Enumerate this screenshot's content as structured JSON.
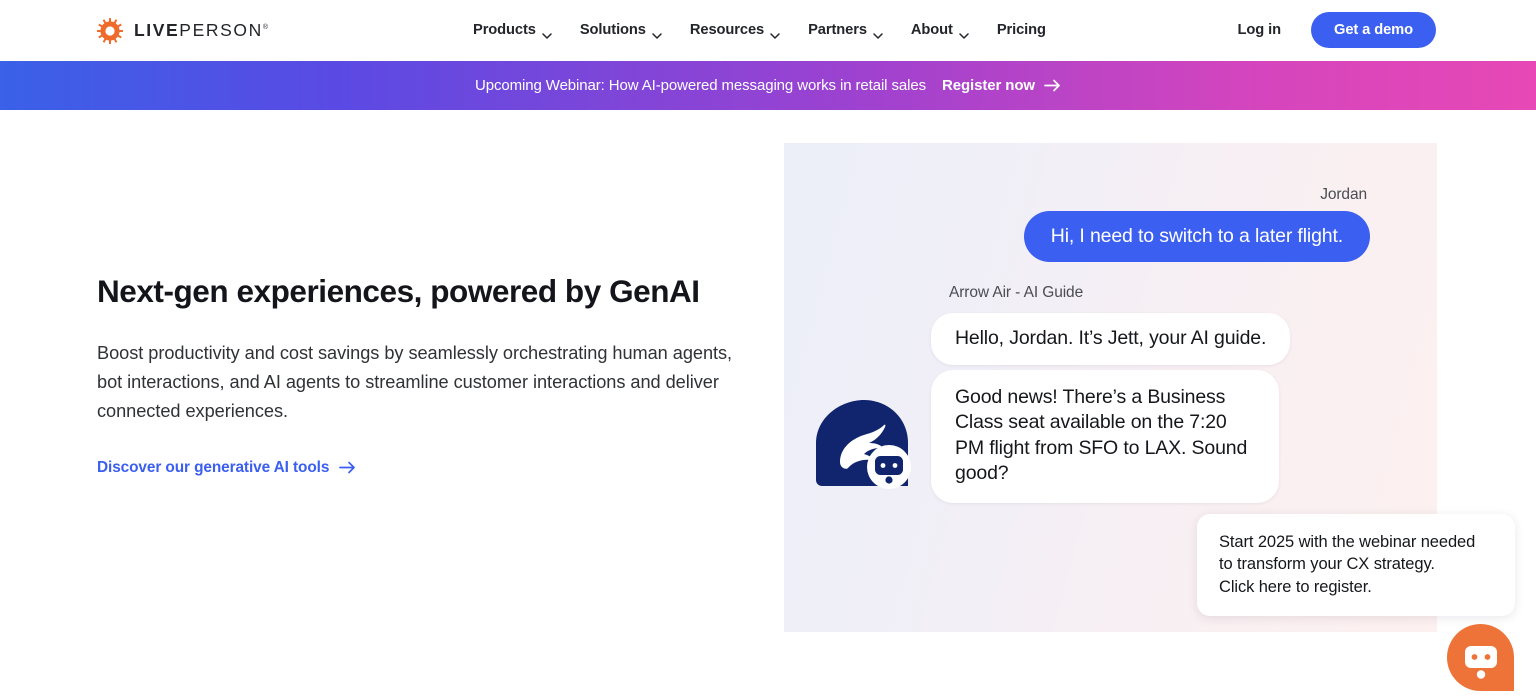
{
  "header": {
    "logo": {
      "icon": "liveperson-sun-icon",
      "text_bold": "LIVE",
      "text_regular": "PERSON",
      "trademark": "®"
    },
    "nav_items": [
      {
        "label": "Products",
        "has_dropdown": true
      },
      {
        "label": "Solutions",
        "has_dropdown": true
      },
      {
        "label": "Resources",
        "has_dropdown": true
      },
      {
        "label": "Partners",
        "has_dropdown": true
      },
      {
        "label": "About",
        "has_dropdown": true
      },
      {
        "label": "Pricing",
        "has_dropdown": false
      }
    ],
    "login_label": "Log in",
    "demo_label": "Get a demo",
    "accent_color": "#3b5ff0"
  },
  "banner": {
    "text": "Upcoming Webinar: How AI-powered messaging works in retail sales",
    "cta_label": "Register now",
    "cta_icon": "arrow-right-icon",
    "gradient_from": "#3a61e8",
    "gradient_to": "#e748b5"
  },
  "hero": {
    "title": "Next-gen experiences, powered by GenAI",
    "body": "Boost productivity and cost savings by seamlessly orchestrating human agents, bot interactions, and AI agents to streamline customer interactions and deliver connected experiences.",
    "link_label": "Discover our generative AI tools",
    "link_icon": "arrow-right-icon",
    "link_color": "#3b5ff0"
  },
  "chat": {
    "user_name": "Jordan",
    "agent_name": "Arrow Air - AI Guide",
    "user_message": "Hi, I need to switch to a later flight.",
    "agent_message_1": "Hello, Jordan. It’s Jett, your AI guide.",
    "agent_message_2": "Good news! There’s a Business Class seat available on the 7:20 PM flight from SFO to LAX. Sound good?",
    "avatar_icon": "arrow-air-bot-avatar-icon",
    "user_bubble_color": "#3b5ff0",
    "agent_bubble_color": "#ffffff",
    "avatar_color": "#10256e"
  },
  "tooltip": {
    "line1": "Start 2025 with the webinar needed",
    "line2": "to transform your CX strategy.",
    "line3": "Click here to register."
  },
  "chat_widget": {
    "icon": "chat-bot-icon",
    "color": "#ed7338"
  }
}
